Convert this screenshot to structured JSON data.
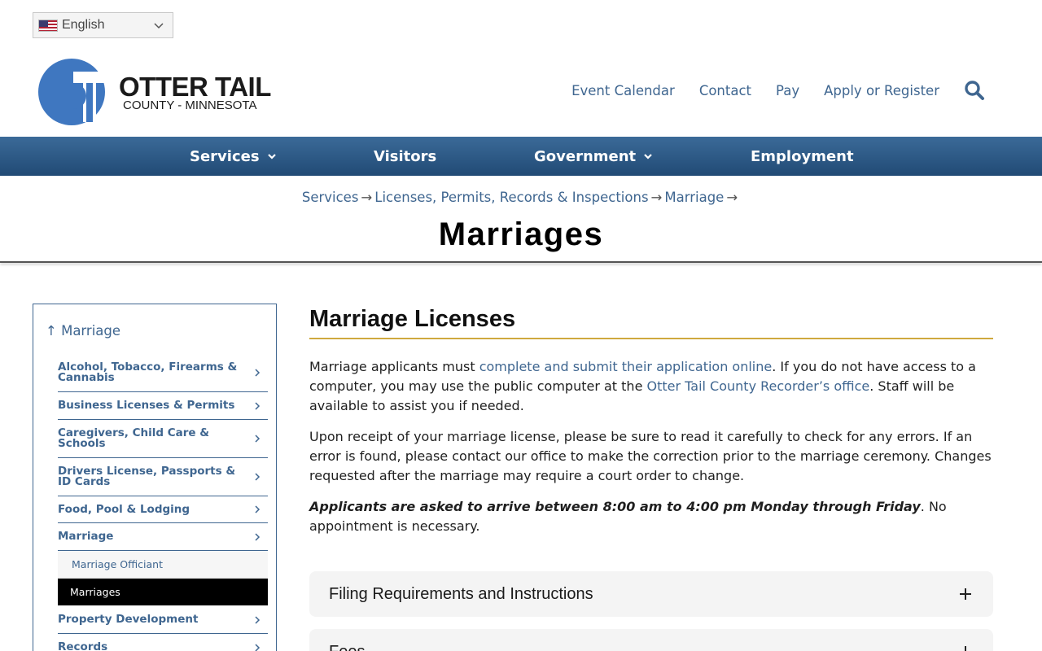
{
  "language": {
    "label": "English",
    "flag_icon": "us-flag-icon"
  },
  "logo": {
    "line1": "OTTER TAIL",
    "line2": "COUNTY - MINNESOTA",
    "brand_color": "#3f77c0"
  },
  "utility_nav": {
    "items": [
      "Event Calendar",
      "Contact",
      "Pay",
      "Apply or Register"
    ],
    "search_icon": "search-icon"
  },
  "main_nav": {
    "items": [
      {
        "label": "Services",
        "dropdown": true
      },
      {
        "label": "Visitors",
        "dropdown": false
      },
      {
        "label": "Government",
        "dropdown": true
      },
      {
        "label": "Employment",
        "dropdown": false
      }
    ]
  },
  "breadcrumb": {
    "items": [
      "Services",
      "Licenses, Permits, Records & Inspections",
      "Marriage"
    ],
    "separator": "→"
  },
  "page_title": "Marriages",
  "sidebar": {
    "up_arrow": "↑",
    "up_label": "Marriage",
    "items": [
      {
        "label": "Alcohol, Tobacco, Firearms & Cannabis"
      },
      {
        "label": "Business Licenses & Permits"
      },
      {
        "label": "Caregivers, Child Care & Schools"
      },
      {
        "label": "Drivers License, Passports & ID Cards"
      },
      {
        "label": "Food, Pool & Lodging"
      },
      {
        "label": "Marriage"
      },
      {
        "label": "Property Development"
      },
      {
        "label": "Records"
      }
    ],
    "sub_items": [
      {
        "label": "Marriage Officiant",
        "active": false
      },
      {
        "label": "Marriages",
        "active": true
      }
    ]
  },
  "content": {
    "heading": "Marriage Licenses",
    "p1_a": "Marriage applicants must ",
    "p1_link1": "complete and submit their application online",
    "p1_b": ". If you do not have access to a computer, you may use the public computer at the ",
    "p1_link2": "Otter Tail County Recorder’s office",
    "p1_c": ". Staff will be available to assist you if needed.",
    "p2": "Upon receipt of your marriage license, please be sure to read it carefully to check for any errors. If an error is found, please contact our office to make the correction prior to the marriage ceremony. Changes requested after the marriage may require a court order to change.",
    "p3_em": "Applicants are asked to arrive between 8:00 am to 4:00 pm Monday through Friday",
    "p3_rest": ". No appointment is necessary."
  },
  "accordions": [
    {
      "label": "Filing Requirements and Instructions"
    },
    {
      "label": "Fees"
    }
  ],
  "colors": {
    "link": "#3f6690",
    "nav_top": "#3b6a98",
    "nav_bottom": "#214a75",
    "accent_rule": "#cfa93e",
    "active_bg": "#000000"
  }
}
